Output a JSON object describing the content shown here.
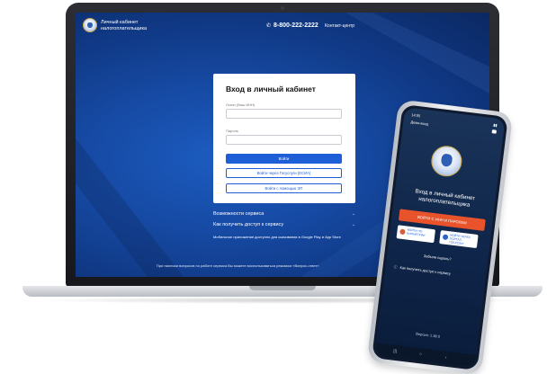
{
  "laptop": {
    "header": {
      "title_line1": "Личный кабинет",
      "title_line2": "налогоплательщика",
      "phone": "8-800-222-2222",
      "contact_label": "Контакт-центр"
    },
    "login": {
      "title": "Вход в личный кабинет",
      "login_label": "Логин (Ваш ИНН)",
      "password_label": "Пароль",
      "login_value": "",
      "password_value": "",
      "submit_label": "Войти",
      "gosuslugi_label": "Войти через Госуслуги (ЕСИА)",
      "ep_label": "Войти с помощью ЭП"
    },
    "links": {
      "features": "Возможности сервиса",
      "access": "Как получить доступ к сервису",
      "mobile_note": "Мобильное приложение доступно для скачивания в Google Play и App Store"
    },
    "footer": {
      "note": "При наличии вопросов по работе сервиса Вы можете воспользоваться режимом «Вопрос-ответ»"
    }
  },
  "phone": {
    "status_time": "14:05",
    "demo_label": "Демо-вход",
    "title_line1": "Вход в личный кабинет",
    "title_line2": "налогоплательщика",
    "gosuslugi_button": "ВОЙТИ С ИНН И ПАРОЛЕМ",
    "tile_left": "ВОЙТИ ПО БИОМЕТРИИ",
    "tile_right": "ВОЙТИ ЧЕРЕЗ ПОРТАЛ ГОСУСЛУГ",
    "forgot_label": "Забыли пароль?",
    "access_label": "Как получить доступ к сервису",
    "version": "Версия: 1.38.0"
  },
  "colors": {
    "screen_blue": "#164aa4",
    "primary_button": "#1e5fd8",
    "orange_button": "#e8532b"
  },
  "icons": {
    "emblem": "fns-emblem-icon",
    "phone": "phone-icon",
    "chevron": "chevron-down-icon",
    "question": "question-circle-icon"
  }
}
